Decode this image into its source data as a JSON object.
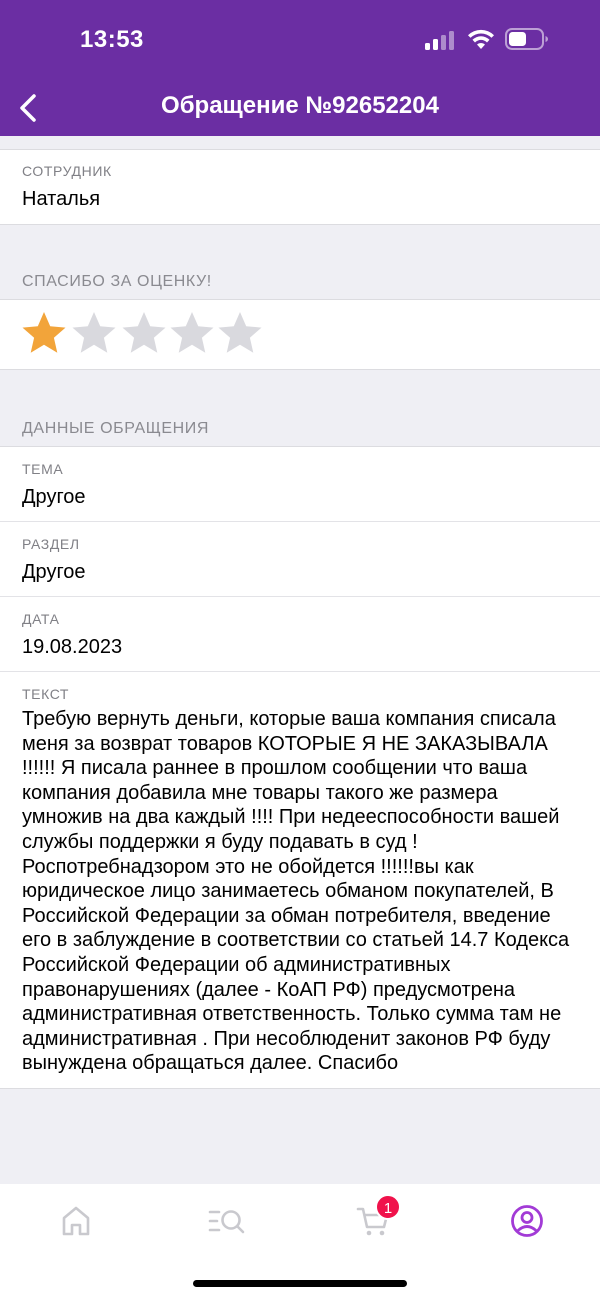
{
  "status_bar": {
    "time": "13:53"
  },
  "nav": {
    "title": "Обращение №92652204",
    "back_icon": "chevron-left-icon"
  },
  "employee": {
    "label": "СОТРУДНИК",
    "value": "Наталья"
  },
  "rating": {
    "header": "СПАСИБО ЗА ОЦЕНКУ!",
    "value": 1,
    "max": 5,
    "active_color": "#f2a43a",
    "inactive_color": "#d9d9de"
  },
  "request": {
    "header": "ДАННЫЕ ОБРАЩЕНИЯ",
    "topic": {
      "label": "ТЕМА",
      "value": "Другое"
    },
    "section": {
      "label": "РАЗДЕЛ",
      "value": "Другое"
    },
    "date": {
      "label": "ДАТА",
      "value": "19.08.2023"
    },
    "text": {
      "label": "ТЕКСТ",
      "value": "Требую вернуть деньги, которые ваша компания списала меня за возврат товаров КОТОРЫЕ Я НЕ ЗАКАЗЫВАЛА !!!!!! Я писала раннее в прошлом сообщении что ваша компания добавила мне товары такого же размера умножив на два каждый !!!! При недееспособности вашей службы поддержки я буду подавать в суд ! Роспотребнадзором это не обойдется !!!!!!вы как юридическое лицо занимаетесь обманом покупателей, В Российской Федерации за обман потребителя, введение его в заблуждение в соответствии со статьей 14.7 Кодекса Российской Федерации об административных правонарушениях (далее - КоАП РФ) предусмотрена административная ответственность. Только сумма там не административная . При несоблюденит законов РФ буду вынуждена обращаться далее. Спасибо"
    }
  },
  "tab_bar": {
    "items": [
      {
        "icon": "home-icon"
      },
      {
        "icon": "catalog-search-icon"
      },
      {
        "icon": "cart-icon",
        "badge": "1"
      },
      {
        "icon": "profile-icon",
        "active": true
      }
    ],
    "active_color": "#a23bd6",
    "inactive_color": "#c9c9ce"
  },
  "colors": {
    "brand": "#6b2ea3",
    "badge": "#f0124b"
  }
}
